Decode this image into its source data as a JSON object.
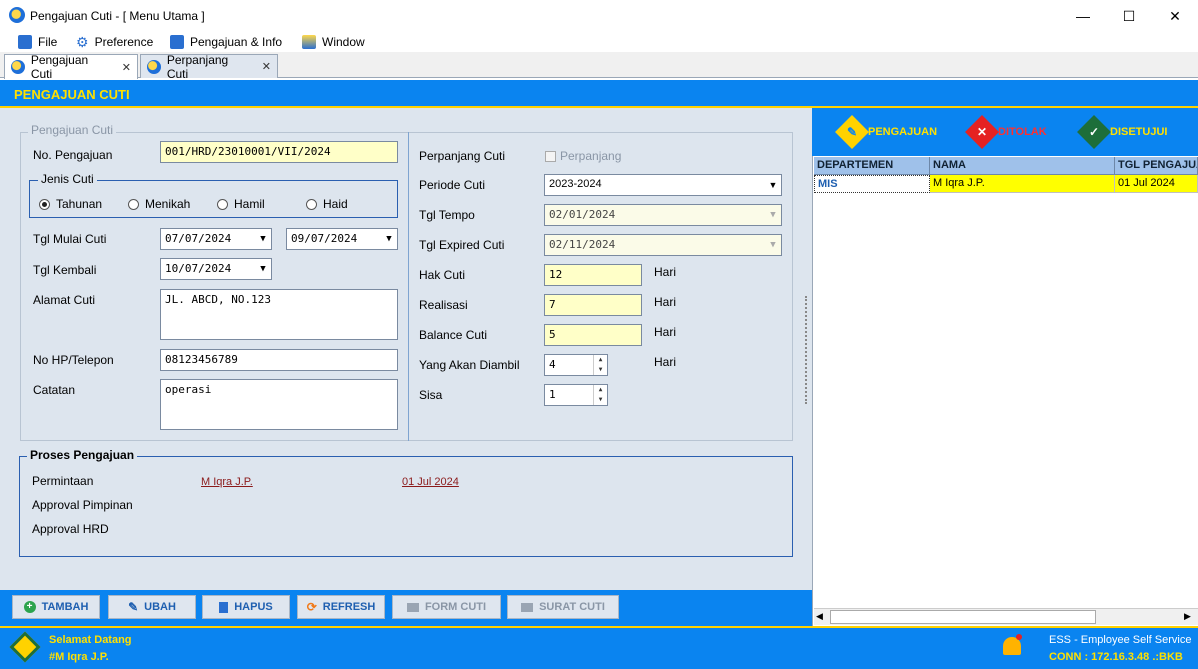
{
  "window": {
    "title": "Pengajuan Cuti - [ Menu Utama ]",
    "controls": {
      "minimize": "—",
      "maximize": "☐",
      "close": "✕"
    }
  },
  "menu": [
    {
      "label": "File",
      "icon": "folder-icon"
    },
    {
      "label": "Preference",
      "icon": "gear-icon"
    },
    {
      "label": "Pengajuan & Info",
      "icon": "edit-icon"
    },
    {
      "label": "Window",
      "icon": "window-icon"
    }
  ],
  "tabs": [
    {
      "label": "Pengajuan Cuti",
      "active": true
    },
    {
      "label": "Perpanjang Cuti",
      "active": false
    }
  ],
  "header": {
    "title": "PENGAJUAN CUTI"
  },
  "form": {
    "group_title": "Pengajuan Cuti",
    "no_pengajuan": {
      "label": "No. Pengajuan",
      "value": "001/HRD/23010001/VII/2024"
    },
    "jenis_cuti": {
      "title": "Jenis Cuti",
      "options": [
        "Tahunan",
        "Menikah",
        "Hamil",
        "Haid"
      ],
      "selected": "Tahunan"
    },
    "tgl_mulai": {
      "label": "Tgl Mulai Cuti",
      "value_start": "07/07/2024",
      "value_end": "09/07/2024"
    },
    "tgl_kembali": {
      "label": "Tgl Kembali",
      "value": "10/07/2024"
    },
    "alamat": {
      "label": "Alamat Cuti",
      "value": "JL. ABCD, NO.123"
    },
    "telepon": {
      "label": "No HP/Telepon",
      "value": "08123456789"
    },
    "catatan": {
      "label": "Catatan",
      "value": "operasi"
    },
    "perpanjang": {
      "label": "Perpanjang Cuti",
      "checkbox_label": "Perpanjang",
      "checked": false
    },
    "periode": {
      "label": "Periode Cuti",
      "value": "2023-2024"
    },
    "tgl_tempo": {
      "label": "Tgl Tempo",
      "value": "02/01/2024"
    },
    "tgl_expired": {
      "label": "Tgl Expired Cuti",
      "value": "02/11/2024"
    },
    "hak_cuti": {
      "label": "Hak Cuti",
      "value": "12",
      "unit": "Hari"
    },
    "realisasi": {
      "label": "Realisasi",
      "value": "7",
      "unit": "Hari"
    },
    "balance": {
      "label": "Balance Cuti",
      "value": "5",
      "unit": "Hari"
    },
    "akan_diambil": {
      "label": "Yang Akan Diambil",
      "value": "4",
      "unit": "Hari"
    },
    "sisa": {
      "label": "Sisa",
      "value": "1"
    }
  },
  "proses": {
    "title": "Proses Pengajuan",
    "permintaan": {
      "label": "Permintaan",
      "name": "M Iqra J.P.",
      "date": "01 Jul 2024"
    },
    "approval_pimpinan": {
      "label": "Approval Pimpinan"
    },
    "approval_hrd": {
      "label": "Approval HRD"
    }
  },
  "toolbar": {
    "tambah": "TAMBAH",
    "ubah": "UBAH",
    "hapus": "HAPUS",
    "refresh": "REFRESH",
    "form_cuti": "FORM CUTI",
    "surat_cuti": "SURAT CUTI"
  },
  "status_tabs": {
    "pengajuan": "PENGAJUAN",
    "ditolak": "DITOLAK",
    "disetujui": "DISETUJUI"
  },
  "grid": {
    "columns": [
      "DEPARTEMEN",
      "NAMA",
      "TGL PENGAJUAN"
    ],
    "rows": [
      [
        "MIS",
        "M Iqra J.P.",
        "01 Jul 2024"
      ]
    ]
  },
  "statusbar": {
    "welcome": "Selamat Datang",
    "user": "#M Iqra J.P.",
    "app": "ESS - Employee Self Service",
    "conn": "CONN : 172.16.3.48 .:BKB"
  },
  "colors": {
    "accent": "#0a84f0",
    "highlight": "#ffe000",
    "row_selected": "#ffff00"
  }
}
